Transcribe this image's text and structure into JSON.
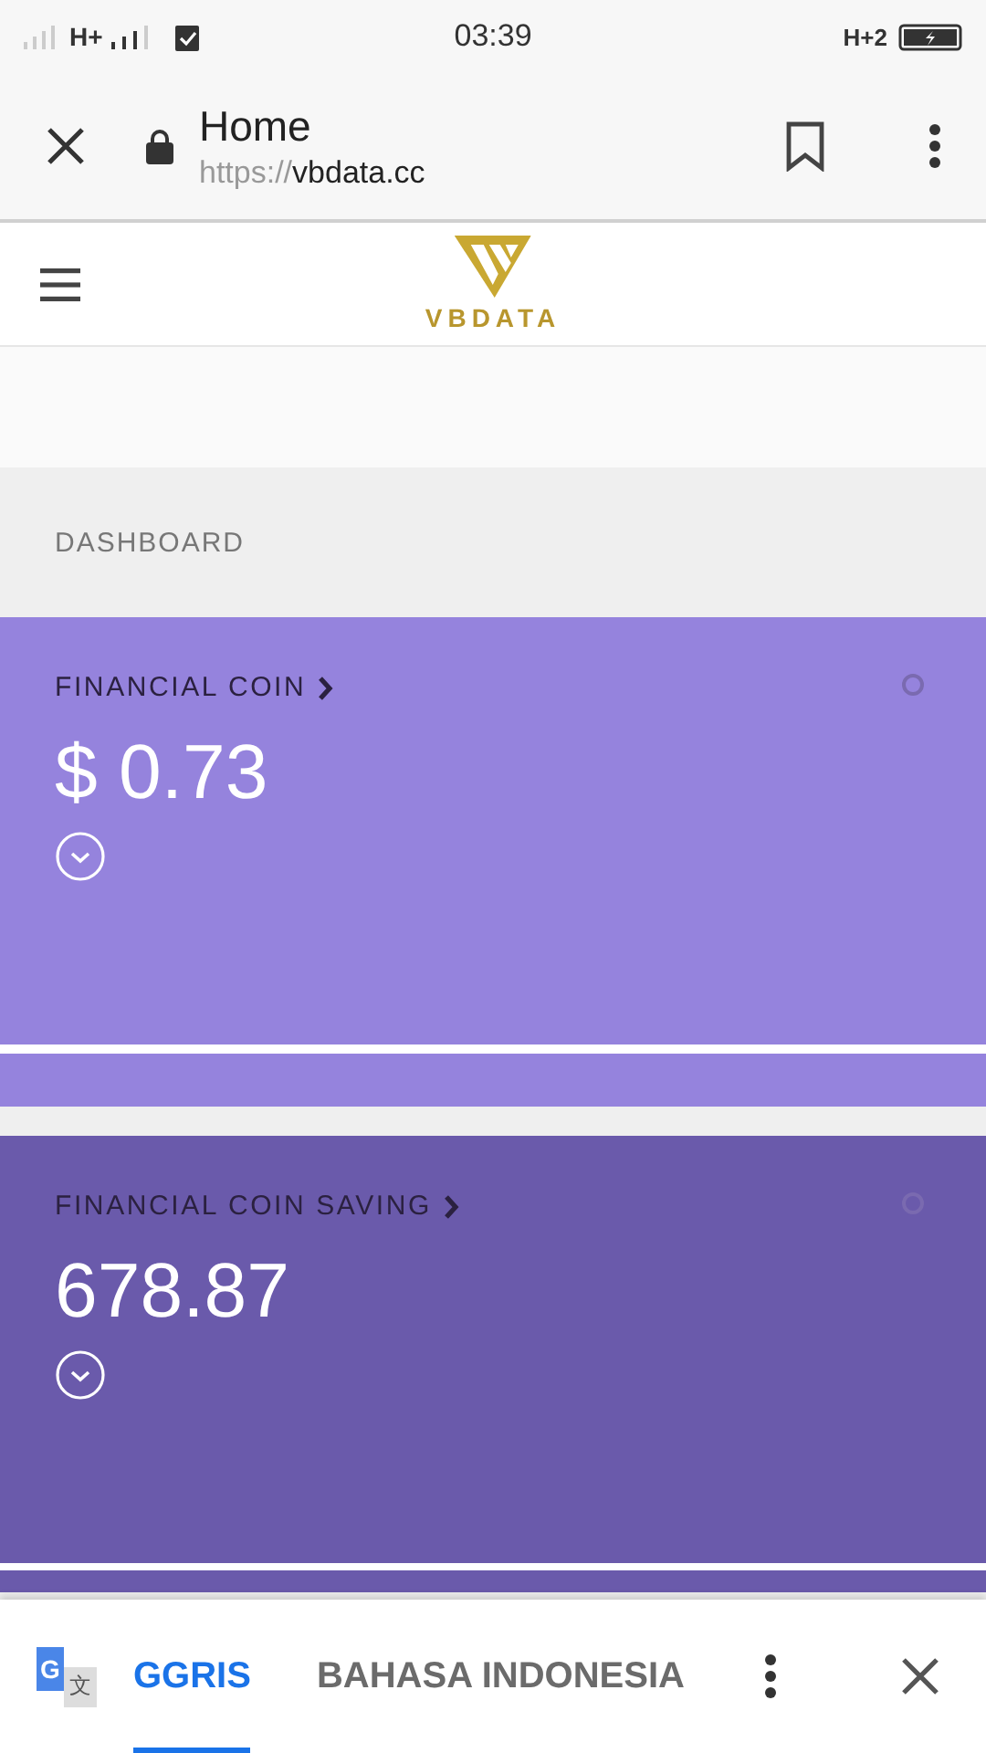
{
  "status_bar": {
    "network_1": "H+",
    "time": "03:39",
    "network_2": "H+2"
  },
  "browser_bar": {
    "title": "Home",
    "url_scheme": "https://",
    "url_host": "vbdata.cc"
  },
  "site_header": {
    "logo_text": "VBDATA"
  },
  "section_label": "DASHBOARD",
  "cards": [
    {
      "title": "FINANCIAL COIN",
      "value": "$ 0.73",
      "color": "#9583dd"
    },
    {
      "title": "FINANCIAL COIN SAVING",
      "value": "678.87",
      "color": "#6a5aab"
    }
  ],
  "translate_bar": {
    "icon_front": "G",
    "icon_back": "文",
    "tabs": [
      {
        "label": "GGRIS",
        "selected": true
      },
      {
        "label": "BAHASA INDONESIA",
        "selected": false
      }
    ]
  }
}
